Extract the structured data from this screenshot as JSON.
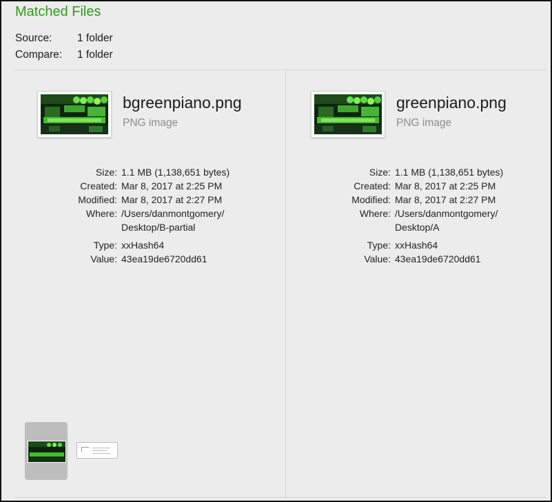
{
  "header": {
    "title": "Matched Files"
  },
  "summary": {
    "source_label": "Source:",
    "source_value": "1 folder",
    "compare_label": "Compare:",
    "compare_value": "1 folder"
  },
  "left": {
    "filename": "bgreenpiano.png",
    "kind": "PNG image",
    "labels": {
      "size": "Size:",
      "created": "Created:",
      "modified": "Modified:",
      "where": "Where:",
      "type": "Type:",
      "value": "Value:"
    },
    "size": "1.1 MB (1,138,651 bytes)",
    "created": "Mar 8, 2017 at 2:25 PM",
    "modified": "Mar 8, 2017 at 2:27 PM",
    "where_line1": "/Users/danmontgomery/",
    "where_line2": "Desktop/B-partial",
    "hash_type": "xxHash64",
    "hash_value": "43ea19de6720dd61"
  },
  "right": {
    "filename": "greenpiano.png",
    "kind": "PNG image",
    "labels": {
      "size": "Size:",
      "created": "Created:",
      "modified": "Modified:",
      "where": "Where:",
      "type": "Type:",
      "value": "Value:"
    },
    "size": "1.1 MB (1,138,651 bytes)",
    "created": "Mar 8, 2017 at 2:25 PM",
    "modified": "Mar 8, 2017 at 2:27 PM",
    "where_line1": "/Users/danmontgomery/",
    "where_line2": "Desktop/A",
    "hash_type": "xxHash64",
    "hash_value": "43ea19de6720dd61"
  },
  "colors": {
    "title_green": "#2f9a1c",
    "thumbnail_green": "#3fbf2a"
  }
}
